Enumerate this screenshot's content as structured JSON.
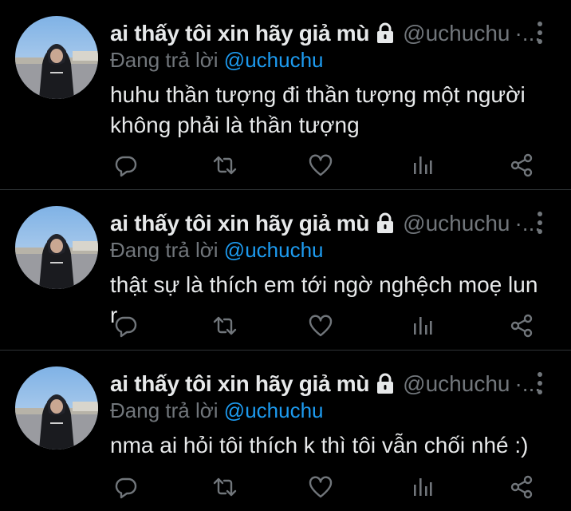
{
  "tweets": [
    {
      "display_name": "ai thấy tôi xin hãy giả mù",
      "handle": "@uchuchu",
      "separator": "·...",
      "replying_prefix": "Đang trả lời",
      "replying_to": "@uchuchu",
      "text": "huhu thần tượng đi thần tượng một người không phải là thần tượng"
    },
    {
      "display_name": "ai thấy tôi xin hãy giả mù",
      "handle": "@uchuchu",
      "separator": "·...",
      "replying_prefix": "Đang trả lời",
      "replying_to": "@uchuchu",
      "text": "thật sự là thích em tới ngờ nghệch moẹ lun r"
    },
    {
      "display_name": "ai thấy tôi xin hãy giả mù",
      "handle": "@uchuchu",
      "separator": "·...",
      "replying_prefix": "Đang trả lời",
      "replying_to": "@uchuchu",
      "text": "nma ai hỏi tôi thích k thì tôi vẫn chối nhé :)"
    }
  ],
  "icons": {
    "lock": "lock-icon",
    "more": "more-vertical-icon",
    "reply": "reply-icon",
    "retweet": "retweet-icon",
    "like": "heart-icon",
    "stats": "analytics-icon",
    "share": "share-icon"
  },
  "colors": {
    "background": "#000000",
    "text_primary": "#e7e9ea",
    "text_secondary": "#71767b",
    "accent": "#1d9bf0",
    "divider": "#2f3336"
  }
}
